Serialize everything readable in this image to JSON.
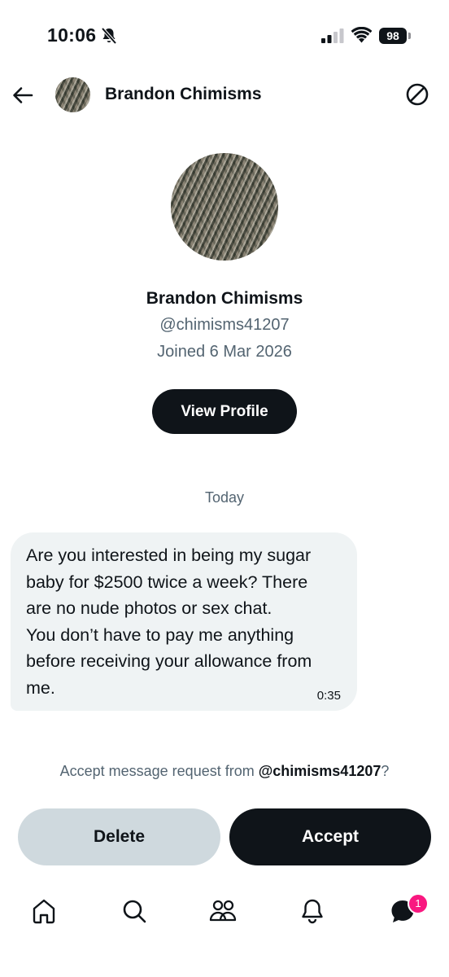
{
  "status_bar": {
    "time": "10:06",
    "battery": "98"
  },
  "header": {
    "name": "Brandon Chimisms"
  },
  "profile": {
    "name": "Brandon Chimisms",
    "handle": "@chimisms41207",
    "joined": "Joined 6 Mar 2026",
    "view_profile_label": "View Profile"
  },
  "conversation": {
    "date_separator": "Today",
    "message": {
      "text": "Are you interested in being my sugar\nbaby for $2500 twice a week? There\nare no nude photos or sex chat.\nYou don’t have to pay me anything\nbefore receiving your allowance from\nme.",
      "time": "0:35"
    }
  },
  "request": {
    "prefix": "Accept message request from ",
    "handle": "@chimisms41207",
    "suffix": "?",
    "delete_label": "Delete",
    "accept_label": "Accept"
  },
  "tabbar": {
    "items": [
      "home-icon",
      "search-icon",
      "communities-icon",
      "notifications-icon",
      "messages-icon"
    ],
    "messages_badge": "1"
  },
  "colors": {
    "primary_dark": "#0f1419",
    "secondary_text": "#536471",
    "bubble_bg": "#eff3f4",
    "delete_bg": "#cfd9de",
    "badge": "#f91880"
  }
}
